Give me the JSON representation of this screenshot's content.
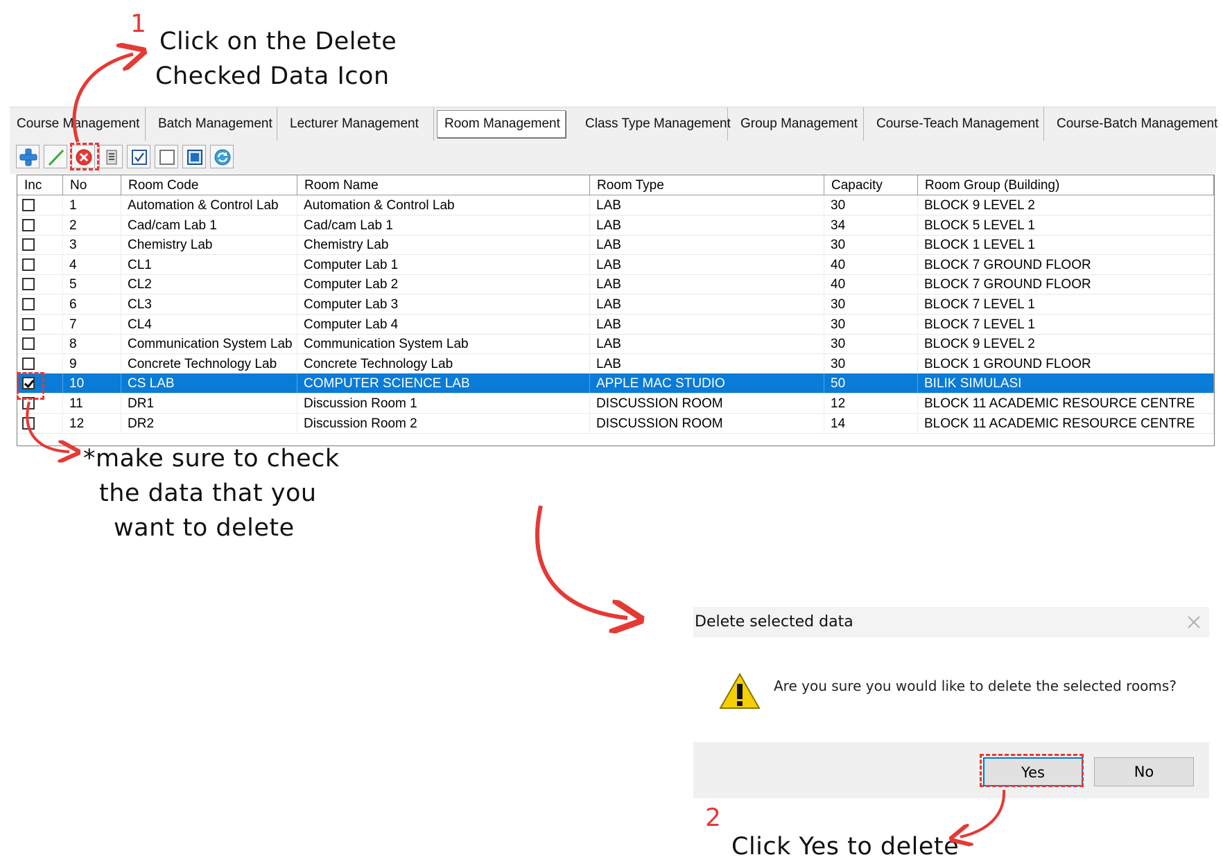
{
  "annotations": {
    "step1_number": "1",
    "step1_text_line1": "Click on the Delete",
    "step1_text_line2": "Checked Data Icon",
    "check_note_line1": "*make sure to check",
    "check_note_line2": "the data that you",
    "check_note_line3": "want to delete",
    "step2_number": "2",
    "step2_text": "Click Yes to delete"
  },
  "tabs": [
    {
      "label": "Course Management"
    },
    {
      "label": "Batch Management"
    },
    {
      "label": "Lecturer Management"
    },
    {
      "label": "Room Management",
      "active": true
    },
    {
      "label": "Class Type Management"
    },
    {
      "label": "Group Management"
    },
    {
      "label": "Course-Teach Management"
    },
    {
      "label": "Course-Batch Management"
    }
  ],
  "toolbar": {
    "icons": [
      "add-icon",
      "edit-icon",
      "delete-checked-icon",
      "print-icon",
      "check-all-icon",
      "uncheck-all-icon",
      "select-icon",
      "refresh-icon"
    ]
  },
  "grid": {
    "columns": [
      "Inc",
      "No",
      "Room Code",
      "Room Name",
      "Room Type",
      "Capacity",
      "Room Group (Building)"
    ],
    "rows": [
      {
        "checked": false,
        "no": "1",
        "code": "Automation & Control Lab",
        "name": "Automation & Control Lab",
        "type": "LAB",
        "capacity": "30",
        "group": "BLOCK 9 LEVEL 2"
      },
      {
        "checked": false,
        "no": "2",
        "code": "Cad/cam Lab 1",
        "name": "Cad/cam Lab 1",
        "type": "LAB",
        "capacity": "34",
        "group": "BLOCK 5 LEVEL 1"
      },
      {
        "checked": false,
        "no": "3",
        "code": "Chemistry Lab",
        "name": "Chemistry Lab",
        "type": "LAB",
        "capacity": "30",
        "group": "BLOCK 1 LEVEL 1"
      },
      {
        "checked": false,
        "no": "4",
        "code": "CL1",
        "name": "Computer Lab 1",
        "type": "LAB",
        "capacity": "40",
        "group": "BLOCK 7 GROUND FLOOR"
      },
      {
        "checked": false,
        "no": "5",
        "code": "CL2",
        "name": "Computer Lab 2",
        "type": "LAB",
        "capacity": "40",
        "group": "BLOCK 7 GROUND FLOOR"
      },
      {
        "checked": false,
        "no": "6",
        "code": "CL3",
        "name": "Computer Lab 3",
        "type": "LAB",
        "capacity": "30",
        "group": "BLOCK 7 LEVEL 1"
      },
      {
        "checked": false,
        "no": "7",
        "code": "CL4",
        "name": "Computer Lab 4",
        "type": "LAB",
        "capacity": "30",
        "group": "BLOCK 7 LEVEL 1"
      },
      {
        "checked": false,
        "no": "8",
        "code": "Communication System Lab",
        "name": "Communication System Lab",
        "type": "LAB",
        "capacity": "30",
        "group": "BLOCK 9 LEVEL 2"
      },
      {
        "checked": false,
        "no": "9",
        "code": "Concrete Technology Lab",
        "name": "Concrete Technology Lab",
        "type": "LAB",
        "capacity": "30",
        "group": "BLOCK 1 GROUND FLOOR"
      },
      {
        "checked": true,
        "selected": true,
        "no": "10",
        "code": "CS LAB",
        "name": "COMPUTER SCIENCE LAB",
        "type": "APPLE MAC STUDIO",
        "capacity": "50",
        "group": "BILIK SIMULASI"
      },
      {
        "checked": false,
        "no": "11",
        "code": "DR1",
        "name": "Discussion Room 1",
        "type": "DISCUSSION ROOM",
        "capacity": "12",
        "group": "BLOCK 11 ACADEMIC RESOURCE CENTRE"
      },
      {
        "checked": false,
        "no": "12",
        "code": "DR2",
        "name": "Discussion Room 2",
        "type": "DISCUSSION ROOM",
        "capacity": "14",
        "group": "BLOCK 11 ACADEMIC RESOURCE CENTRE"
      }
    ]
  },
  "dialog": {
    "title": "Delete selected data",
    "message": "Are you sure you would like to delete the selected rooms?",
    "yes_label": "Yes",
    "no_label": "No",
    "icon": "warning-icon"
  },
  "colors": {
    "annotation_red": "#e53935",
    "selection_blue": "#0a7bd7"
  }
}
